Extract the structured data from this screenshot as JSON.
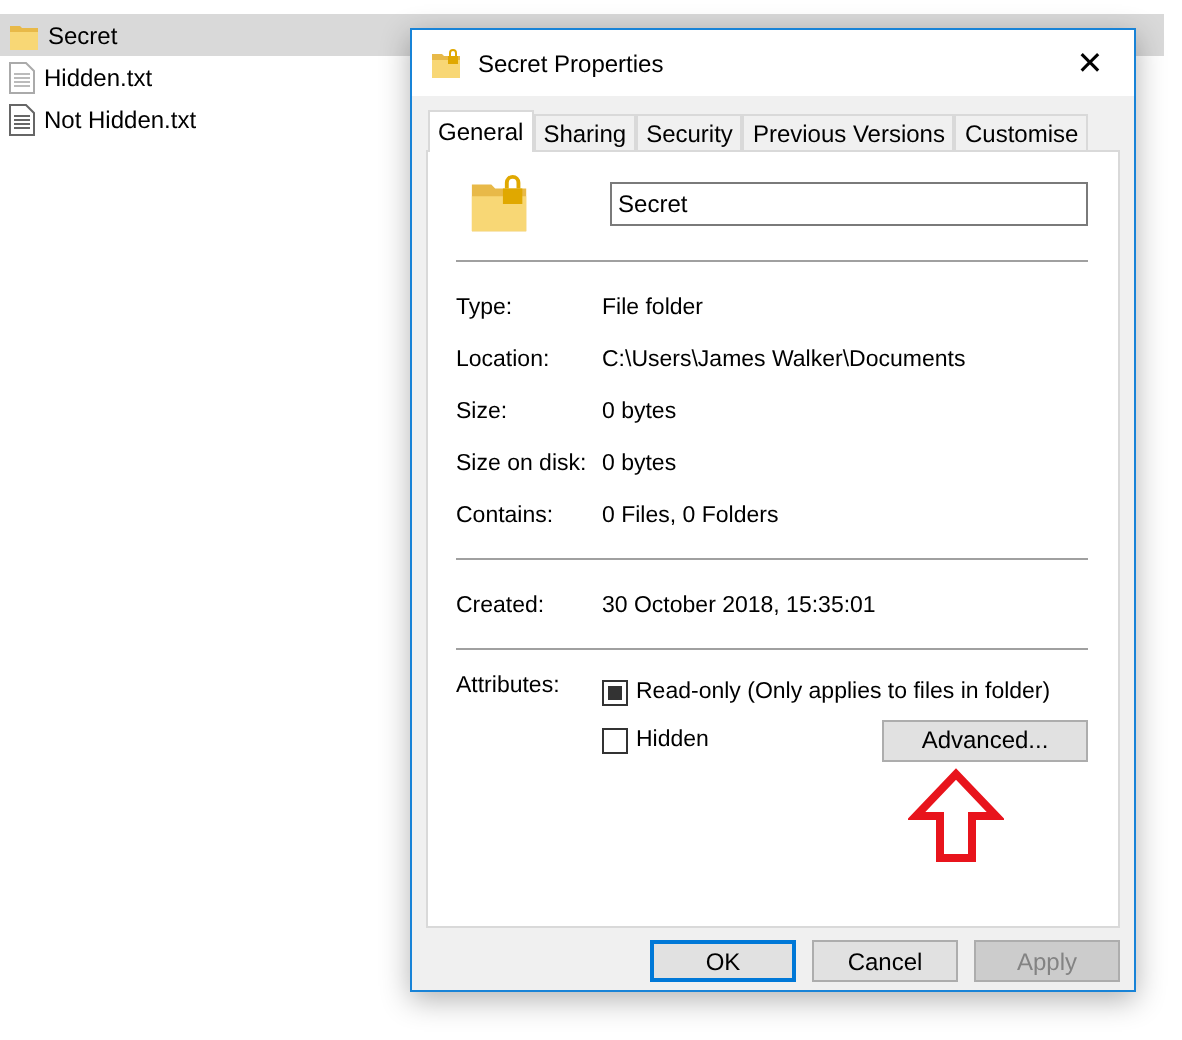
{
  "files": [
    {
      "name": "Secret",
      "kind": "folder",
      "selected": true
    },
    {
      "name": "Hidden.txt",
      "kind": "file",
      "selected": false
    },
    {
      "name": "Not Hidden.txt",
      "kind": "file",
      "selected": false
    }
  ],
  "dialog": {
    "title": "Secret Properties",
    "close": "✕",
    "tabs": [
      {
        "label": "General",
        "selected": true
      },
      {
        "label": "Sharing",
        "selected": false
      },
      {
        "label": "Security",
        "selected": false
      },
      {
        "label": "Previous Versions",
        "selected": false
      },
      {
        "label": "Customise",
        "selected": false
      }
    ],
    "name_value": "Secret",
    "groups": [
      [
        {
          "label": "Type:",
          "value": "File folder"
        },
        {
          "label": "Location:",
          "value": "C:\\Users\\James Walker\\Documents"
        },
        {
          "label": "Size:",
          "value": "0 bytes"
        },
        {
          "label": "Size on disk:",
          "value": "0 bytes"
        },
        {
          "label": "Contains:",
          "value": "0 Files, 0 Folders"
        }
      ],
      [
        {
          "label": "Created:",
          "value": "30 October 2018, 15:35:01"
        }
      ]
    ],
    "attributes_label": "Attributes:",
    "attributes": [
      {
        "label": "Read-only (Only applies to files in folder)",
        "checked": true
      },
      {
        "label": "Hidden",
        "checked": false
      }
    ],
    "advanced": "Advanced...",
    "buttons": [
      {
        "label": "OK",
        "default": true,
        "disabled": false
      },
      {
        "label": "Cancel",
        "default": false,
        "disabled": false
      },
      {
        "label": "Apply",
        "default": false,
        "disabled": true
      }
    ]
  }
}
